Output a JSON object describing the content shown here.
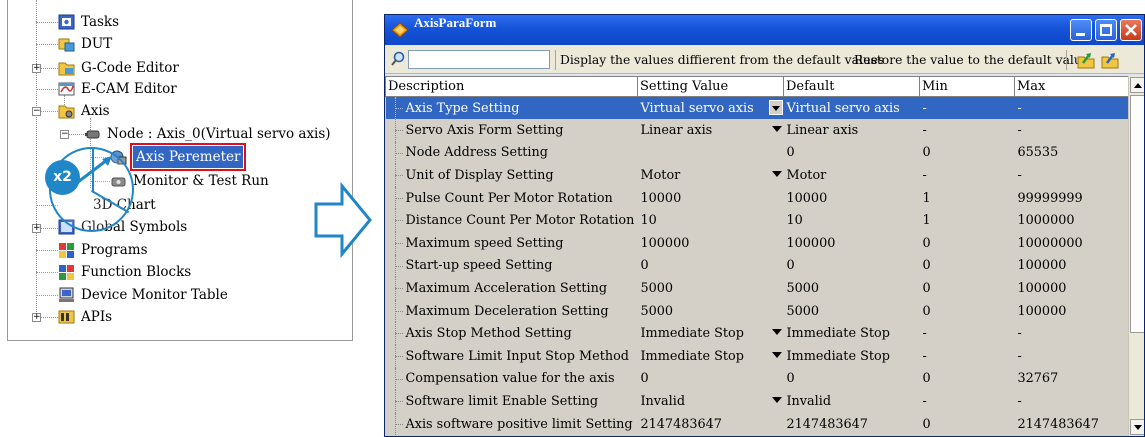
{
  "tree": {
    "items": [
      {
        "label": "Tasks",
        "icon": "tasks-icon"
      },
      {
        "label": "DUT",
        "icon": "dut-icon"
      },
      {
        "label": "G-Code Editor",
        "icon": "gcode-editor-icon"
      },
      {
        "label": "E-CAM Editor",
        "icon": "ecam-editor-icon"
      },
      {
        "label": "Axis",
        "icon": "axis-folder-icon"
      },
      {
        "label": "Node : Axis_0(Virtual servo axis)",
        "icon": "node-icon"
      },
      {
        "label": "Axis Peremeter",
        "icon": "axis-parameter-icon"
      },
      {
        "label": "Monitor & Test Run",
        "icon": "monitor-test-run-icon"
      },
      {
        "label": "3D Chart",
        "icon": "chart-3d-icon"
      },
      {
        "label": "Global Symbols",
        "icon": "global-symbols-icon"
      },
      {
        "label": "Programs",
        "icon": "programs-icon"
      },
      {
        "label": "Function Blocks",
        "icon": "function-blocks-icon"
      },
      {
        "label": "Device Monitor Table",
        "icon": "device-monitor-icon"
      },
      {
        "label": "APIs",
        "icon": "apis-icon"
      }
    ],
    "badge": "x2"
  },
  "window": {
    "title": "AxisParaForm",
    "toolbar": {
      "search_value": "",
      "display_diff_label": "Display the values diffierent from the default values",
      "restore_label": "Restore the value to the default value"
    },
    "columns": [
      "Description",
      "Setting Value",
      "Default",
      "Min",
      "Max"
    ],
    "rows": [
      {
        "desc": "Axis Type Setting",
        "value": "Virtual servo axis",
        "dropdown": true,
        "default": "Virtual servo axis",
        "min": "-",
        "max": "-"
      },
      {
        "desc": "Servo Axis Form Setting",
        "value": "Linear axis",
        "dropdown": true,
        "default": "Linear axis",
        "min": "-",
        "max": "-"
      },
      {
        "desc": "Node Address Setting",
        "value": "",
        "dropdown": false,
        "default": "0",
        "min": "0",
        "max": "65535"
      },
      {
        "desc": "Unit of Display Setting",
        "value": "Motor",
        "dropdown": true,
        "default": "Motor",
        "min": "-",
        "max": "-"
      },
      {
        "desc": "Pulse Count Per Motor Rotation",
        "value": "10000",
        "dropdown": false,
        "default": "10000",
        "min": "1",
        "max": "99999999"
      },
      {
        "desc": "Distance Count Per Motor Rotation",
        "value": "10",
        "dropdown": false,
        "default": "10",
        "min": "1",
        "max": "1000000"
      },
      {
        "desc": "Maximum speed Setting",
        "value": "100000",
        "dropdown": false,
        "default": "100000",
        "min": "0",
        "max": "10000000"
      },
      {
        "desc": "Start-up speed Setting",
        "value": "0",
        "dropdown": false,
        "default": "0",
        "min": "0",
        "max": "100000"
      },
      {
        "desc": "Maximum Acceleration Setting",
        "value": "5000",
        "dropdown": false,
        "default": "5000",
        "min": "0",
        "max": "100000"
      },
      {
        "desc": "Maximum Deceleration Setting",
        "value": "5000",
        "dropdown": false,
        "default": "5000",
        "min": "0",
        "max": "100000"
      },
      {
        "desc": "Axis Stop Method  Setting",
        "value": "Immediate Stop",
        "dropdown": true,
        "default": "Immediate Stop",
        "min": "-",
        "max": "-"
      },
      {
        "desc": "Software Limit Input Stop Method",
        "value": "Immediate Stop",
        "dropdown": true,
        "default": "Immediate Stop",
        "min": "-",
        "max": "-"
      },
      {
        "desc": "Compensation value for the axis",
        "value": "0",
        "dropdown": false,
        "default": "0",
        "min": "0",
        "max": "32767"
      },
      {
        "desc": "Software limit Enable  Setting",
        "value": "Invalid",
        "dropdown": true,
        "default": "Invalid",
        "min": "-",
        "max": "-"
      },
      {
        "desc": "Axis software positive limit Setting",
        "value": "2147483647",
        "dropdown": false,
        "default": "2147483647",
        "min": "0",
        "max": "2147483647"
      }
    ],
    "selected_row": 0
  },
  "colors": {
    "selection": "#3166c3",
    "highlight_box": "#e0101a",
    "accent_blue": "#1f86c8",
    "titlebar": "#1553d7"
  }
}
